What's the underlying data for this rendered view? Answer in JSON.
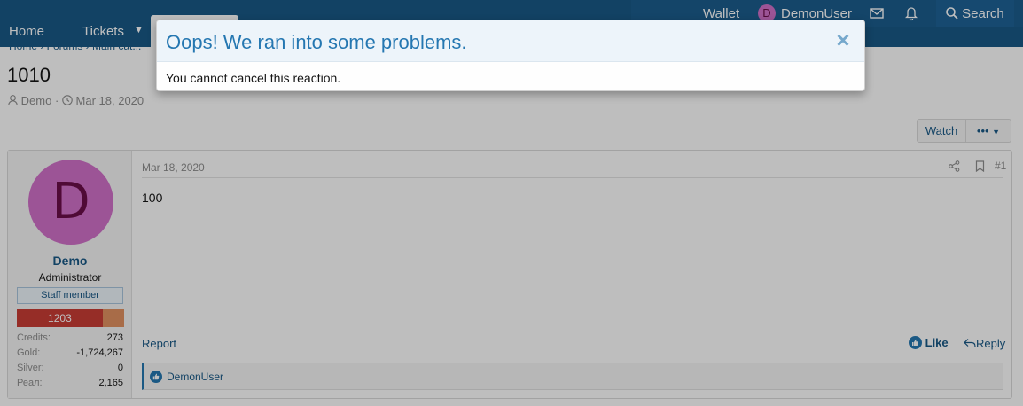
{
  "nav": {
    "home": "Home",
    "tickets": "Tickets",
    "wallet": "Wallet",
    "user_initial": "D",
    "username": "DemonUser",
    "search": "Search"
  },
  "breadcrumb": "Home  ›  Forums  ›  Main cat...",
  "thread": {
    "title": "1010",
    "author": "Demo",
    "date": "Mar 18, 2020"
  },
  "actions": {
    "watch": "Watch",
    "more": "•••"
  },
  "post": {
    "avatar_letter": "D",
    "username": "Demo",
    "user_title": "Administrator",
    "banner": "Staff member",
    "level": "1203",
    "level_fraction": 0.8,
    "stats": [
      {
        "label": "Credits:",
        "value": "273"
      },
      {
        "label": "Gold:",
        "value": "-1,724,267"
      },
      {
        "label": "Silver:",
        "value": "0"
      },
      {
        "label": "Реал:",
        "value": "2,165"
      }
    ],
    "date": "Mar 18, 2020",
    "number": "#1",
    "body": "100",
    "report": "Report",
    "like": "Like",
    "reply": "Reply",
    "reactions_by": "DemonUser"
  },
  "modal": {
    "title": "Oops! We ran into some problems.",
    "close": "×",
    "message": "You cannot cancel this reaction."
  },
  "colors": {
    "accent": "#185886",
    "modal_title": "#2577b1",
    "avatar": "#d070c8"
  }
}
